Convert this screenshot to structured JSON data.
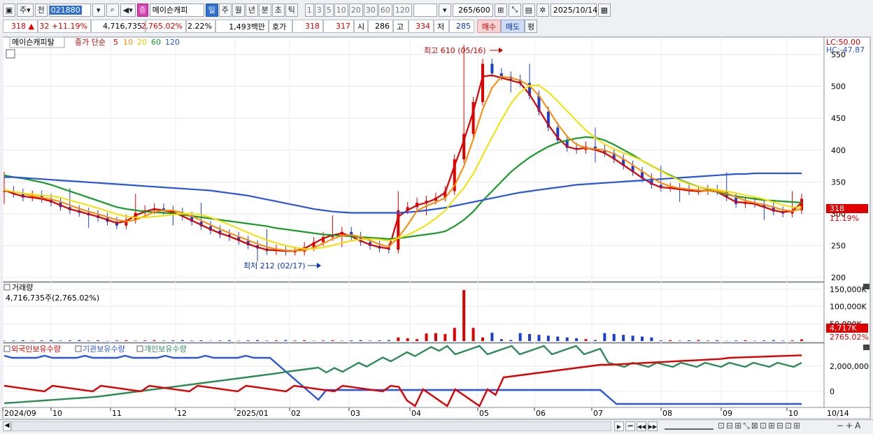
{
  "toolbar": {
    "market": "주",
    "prev": "전",
    "code": "021880",
    "stock_badge": "증",
    "stock_name": "메이슨캐피",
    "periods": [
      "일",
      "주",
      "월",
      "년",
      "분",
      "초",
      "틱"
    ],
    "selected_period": "일",
    "intervals": [
      "1",
      "3",
      "5",
      "10",
      "20",
      "30",
      "60",
      "120"
    ],
    "count": "265",
    "count_total": "/600",
    "date": "2025/10/14"
  },
  "quote": {
    "price": "318",
    "arrow": "▲",
    "change": "32",
    "change_pct": "+11.19%",
    "volume": "4,716,735",
    "volume_ratio": "2,765.02%",
    "turnover_pct": "2.22%",
    "amount": "1,493백만",
    "hoga_label": "호가",
    "ask": "318",
    "bid": "317",
    "open_label": "시",
    "open": "286",
    "high_label": "고",
    "high": "334",
    "low_label": "저",
    "low": "285",
    "buy": "매수",
    "sell": "매도",
    "avg": "평"
  },
  "price_pane": {
    "title": "메이슨캐피탈",
    "series_label": "종가 단순",
    "ma_labels": [
      "5",
      "10",
      "20",
      "60",
      "120"
    ],
    "ma_colors": [
      "#dd0000",
      "#ff8a00",
      "#f5d800",
      "#1a9a2a",
      "#2a55dd"
    ],
    "y_ticks": [
      "550",
      "500",
      "450",
      "400",
      "350",
      "300",
      "250",
      "200"
    ],
    "lc": "LC:50.00",
    "hc": "HC:-47.87",
    "high_note": "최고 610 (05/16)",
    "low_note": "최저 212 (02/17)",
    "last_price": "318",
    "last_pct": "11.19%"
  },
  "volume_pane": {
    "title": "거래량",
    "value": "4,716,735주(2,765.02%)",
    "y_ticks": [
      "150,000K",
      "100,000K",
      "50,000K"
    ],
    "last_vol": "4,717K",
    "last_pct": "2765.02%"
  },
  "holding_pane": {
    "labels": [
      "외국인보유수량",
      "기관보유수량",
      "개인보유수량"
    ],
    "colors": [
      "#dd0000",
      "#2a55dd",
      "#2e8b57"
    ],
    "y_ticks": [
      "2,000,000",
      "0"
    ]
  },
  "x_axis": {
    "labels": [
      "2024/09",
      "10",
      "11",
      "12",
      "2025/01",
      "02",
      "03",
      "04",
      "05",
      "06",
      "07",
      "08",
      "09",
      "10"
    ],
    "right_label": "10/14"
  },
  "chart_data": {
    "type": "line",
    "candles_close_approx": [
      330,
      326,
      320,
      323,
      318,
      312,
      305,
      300,
      296,
      292,
      288,
      282,
      276,
      285,
      296,
      300,
      303,
      299,
      296,
      290,
      282,
      275,
      268,
      262,
      258,
      252,
      245,
      240,
      236,
      238,
      235,
      235,
      242,
      250,
      258,
      262,
      266,
      258,
      250,
      244,
      240,
      238,
      300,
      305,
      312,
      315,
      320,
      330,
      380,
      420,
      470,
      530,
      515,
      510,
      505,
      500,
      480,
      455,
      430,
      410,
      398,
      395,
      400,
      395,
      390,
      380,
      370,
      360,
      350,
      340,
      335,
      335,
      333,
      330,
      330,
      332,
      330,
      320,
      310,
      312,
      310,
      305,
      298,
      295,
      300,
      318
    ],
    "ma_series": [
      {
        "name": "5",
        "values": [
          332,
          326,
          322,
          320,
          318,
          314,
          308,
          302,
          298,
          294,
          290,
          285,
          280,
          283,
          292,
          298,
          302,
          300,
          297,
          291,
          284,
          277,
          270,
          264,
          259,
          253,
          247,
          242,
          238,
          237,
          236,
          236,
          240,
          248,
          256,
          261,
          264,
          259,
          252,
          246,
          242,
          240,
          290,
          300,
          308,
          312,
          318,
          328,
          370,
          410,
          455,
          510,
          512,
          508,
          504,
          500,
          482,
          458,
          434,
          414,
          400,
          396,
          398,
          395,
          390,
          381,
          371,
          361,
          351,
          342,
          336,
          335,
          333,
          331,
          330,
          331,
          329,
          321,
          313,
          312,
          310,
          305,
          300,
          297,
          299,
          312
        ]
      },
      {
        "name": "60",
        "values": [
          355,
          352,
          350,
          347,
          344,
          340,
          335,
          330,
          325,
          320,
          315,
          310,
          305,
          302,
          300,
          298,
          297,
          296,
          295,
          293,
          291,
          289,
          287,
          285,
          283,
          281,
          279,
          277,
          275,
          272,
          270,
          268,
          266,
          264,
          262,
          261,
          260,
          259,
          258,
          257,
          256,
          255,
          256,
          258,
          260,
          262,
          264,
          267,
          275,
          285,
          298,
          315,
          330,
          345,
          360,
          372,
          383,
          392,
          400,
          406,
          410,
          413,
          415,
          414,
          410,
          403,
          395,
          387,
          378,
          370,
          362,
          355,
          348,
          342,
          337,
          333,
          329,
          325,
          322,
          320,
          318,
          316,
          315,
          314,
          313,
          312
        ]
      },
      {
        "name": "120",
        "values": [
          352,
          352,
          351,
          350,
          349,
          348,
          347,
          346,
          345,
          344,
          343,
          342,
          341,
          340,
          339,
          338,
          337,
          336,
          335,
          334,
          333,
          332,
          331,
          329,
          327,
          325,
          323,
          320,
          317,
          314,
          311,
          308,
          305,
          302,
          300,
          298,
          297,
          296,
          296,
          296,
          296,
          296,
          296,
          297,
          298,
          300,
          302,
          304,
          307,
          310,
          313,
          316,
          319,
          322,
          325,
          328,
          330,
          332,
          334,
          336,
          338,
          340,
          341,
          342,
          343,
          344,
          345,
          346,
          347,
          348,
          349,
          350,
          351,
          352,
          353,
          354,
          355,
          356,
          357,
          357,
          358,
          358,
          358,
          358,
          358,
          358
        ]
      }
    ],
    "ylim": [
      200,
      560
    ]
  }
}
